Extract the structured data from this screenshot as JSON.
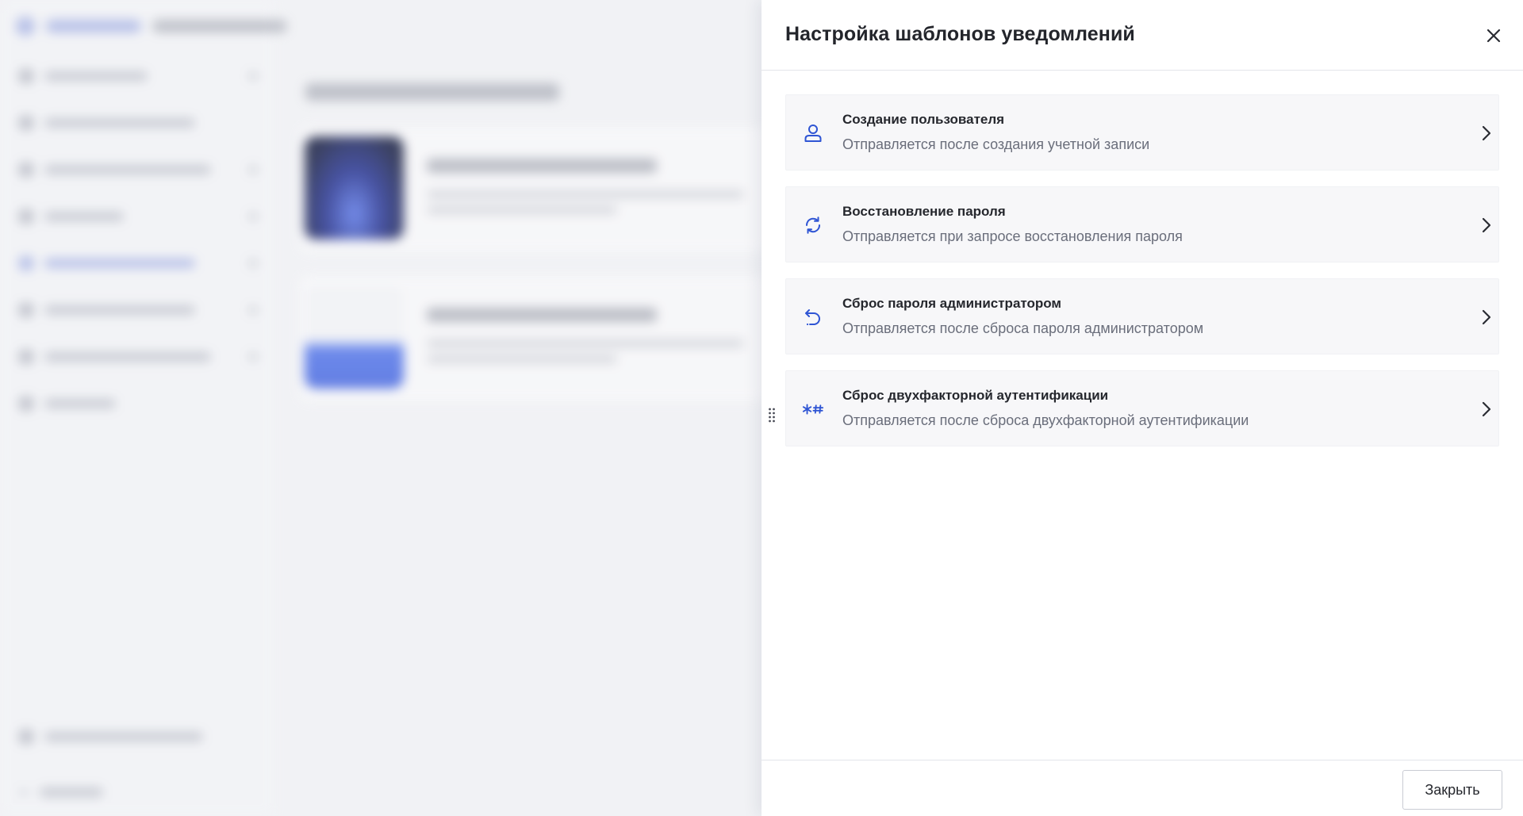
{
  "drawer": {
    "title": "Настройка шаблонов уведомлений",
    "close_icon": "close-icon",
    "close_button_label": "Закрыть",
    "accent_color": "#2f55d4",
    "templates": [
      {
        "icon": "user-icon",
        "title": "Создание пользователя",
        "description": "Отправляется после создания учетной записи"
      },
      {
        "icon": "refresh-icon",
        "title": "Восстановление пароля",
        "description": "Отправляется при запросе восстановления пароля"
      },
      {
        "icon": "undo-icon",
        "title": "Сброс пароля администратором",
        "description": "Отправляется после сброса пароля администратором"
      },
      {
        "icon": "asterisk-hash-icon",
        "title": "Сброс двухфакторной аутентификации",
        "description": "Отправляется после сброса двухфакторной аутентификации"
      }
    ]
  }
}
